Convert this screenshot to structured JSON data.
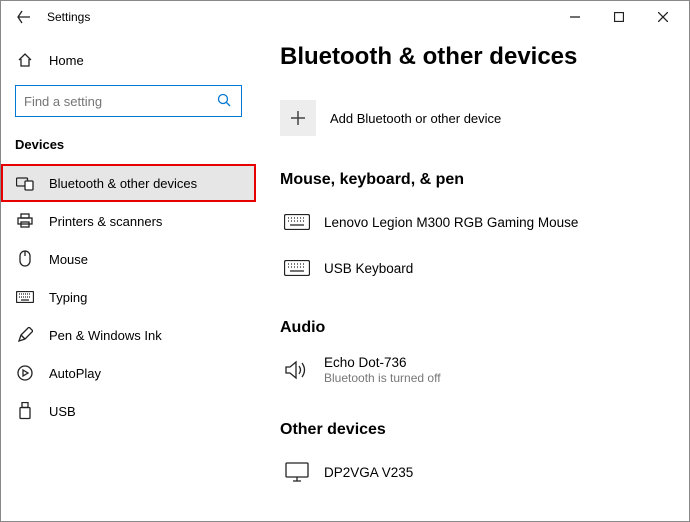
{
  "window": {
    "title": "Settings"
  },
  "sidebar": {
    "home_label": "Home",
    "search_placeholder": "Find a setting",
    "section_label": "Devices",
    "items": [
      {
        "label": "Bluetooth & other devices"
      },
      {
        "label": "Printers & scanners"
      },
      {
        "label": "Mouse"
      },
      {
        "label": "Typing"
      },
      {
        "label": "Pen & Windows Ink"
      },
      {
        "label": "AutoPlay"
      },
      {
        "label": "USB"
      }
    ]
  },
  "main": {
    "title": "Bluetooth & other devices",
    "add_label": "Add Bluetooth or other device",
    "sections": {
      "mouse_kbd": {
        "heading": "Mouse, keyboard, & pen",
        "items": [
          {
            "label": "Lenovo Legion M300 RGB Gaming Mouse"
          },
          {
            "label": "USB Keyboard"
          }
        ]
      },
      "audio": {
        "heading": "Audio",
        "items": [
          {
            "label": "Echo Dot-736",
            "sub": "Bluetooth is turned off"
          }
        ]
      },
      "other": {
        "heading": "Other devices",
        "items": [
          {
            "label": "DP2VGA V235"
          }
        ]
      }
    }
  }
}
